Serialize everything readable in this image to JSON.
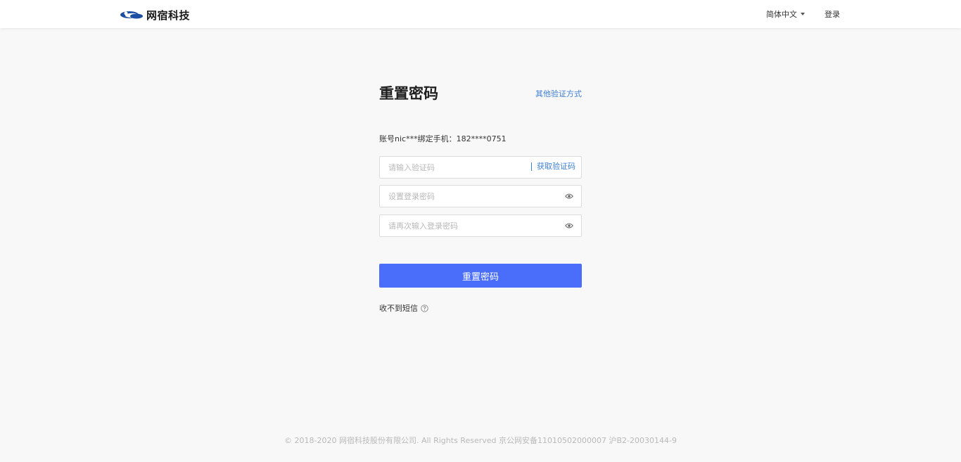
{
  "header": {
    "logo_text": "网宿科技",
    "language_label": "简体中文",
    "login_label": "登录"
  },
  "form": {
    "title": "重置密码",
    "other_verify_label": "其他验证方式",
    "bind_info": "账号nic***绑定手机：182****0751",
    "code_placeholder": "请输入验证码",
    "get_code_label": "获取验证码",
    "password_placeholder": "设置登录密码",
    "confirm_placeholder": "请再次输入登录密码",
    "submit_label": "重置密码",
    "no_sms_label": "收不到短信"
  },
  "footer": {
    "copyright": "© 2018-2020 网宿科技股份有限公司. All Rights Reserved 京公网安备11010502000007 沪B2-20030144-9"
  },
  "colors": {
    "accent": "#4a6ef9",
    "link": "#3e7fd6",
    "background": "#f8f8f8"
  },
  "icons": [
    "logo-mark-icon",
    "caret-down-icon",
    "eye-icon",
    "question-circle-icon"
  ]
}
